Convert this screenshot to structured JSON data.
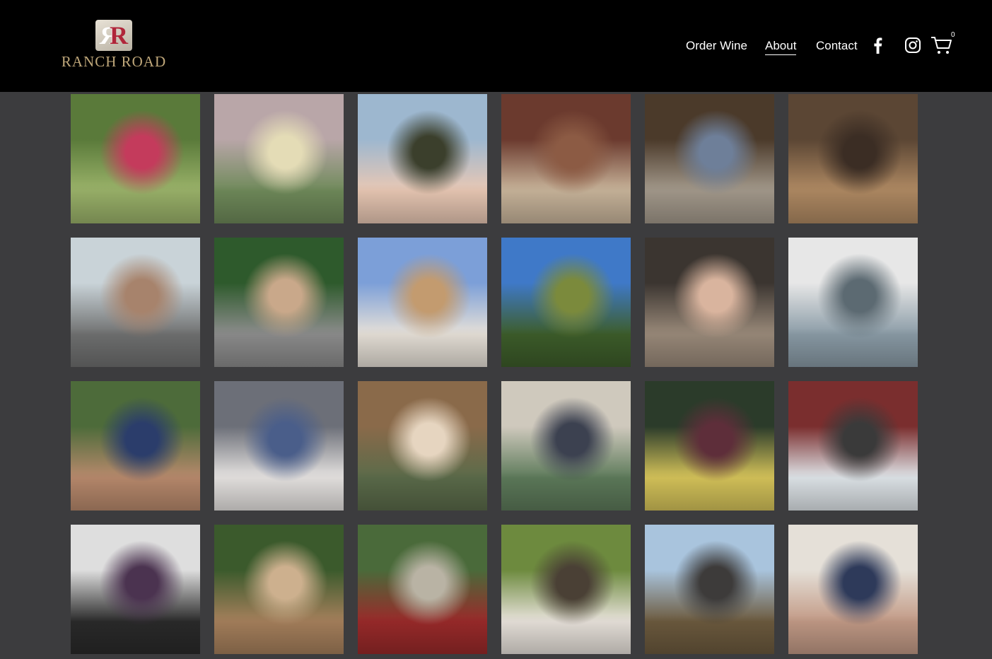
{
  "brand": {
    "name": "Ranch Road",
    "logo_text": "RANCH ROAD"
  },
  "nav": {
    "items": [
      {
        "label": "Order Wine",
        "active": false
      },
      {
        "label": "About",
        "active": true
      },
      {
        "label": "Contact",
        "active": false
      }
    ],
    "social": [
      "facebook-icon",
      "instagram-icon"
    ],
    "cart_count": "0"
  },
  "gallery": {
    "photos": [
      {
        "name": "woman-lounging-vineyard-photo",
        "colors": [
          "#5a7a3a",
          "#9bb36a",
          "#c43b5c"
        ]
      },
      {
        "name": "white-wine-glass-sunset-photo",
        "colors": [
          "#b9a6a8",
          "#6f8a5a",
          "#e4dcb6"
        ]
      },
      {
        "name": "ranch-road-wine-bottle-photo",
        "colors": [
          "#9db7cf",
          "#e9c8b4",
          "#3b3f2c"
        ]
      },
      {
        "name": "barrel-rack-photo",
        "colors": [
          "#6b3a2e",
          "#c9b59b",
          "#8c5b44"
        ]
      },
      {
        "name": "man-with-wine-glass-photo",
        "colors": [
          "#4b3a2a",
          "#a49a8c",
          "#6e7f99"
        ]
      },
      {
        "name": "woman-in-barrel-room-photo",
        "colors": [
          "#5b4634",
          "#b08a63",
          "#3b2d24"
        ]
      },
      {
        "name": "group-toasting-outdoors-photo",
        "colors": [
          "#c9d3d8",
          "#6f7070",
          "#a7836c"
        ]
      },
      {
        "name": "harvest-trailer-photo",
        "colors": [
          "#2e5a2c",
          "#8d8d8d",
          "#c9a88a"
        ]
      },
      {
        "name": "couple-smiling-photo",
        "colors": [
          "#7c9fd8",
          "#e7e1d8",
          "#c39b6f"
        ]
      },
      {
        "name": "hillside-vineyard-photo",
        "colors": [
          "#3f79c8",
          "#3d5d2a",
          "#7b8a3c"
        ]
      },
      {
        "name": "women-group-tasting-room-photo",
        "colors": [
          "#3b3530",
          "#9a8a7a",
          "#d9b49e"
        ]
      },
      {
        "name": "man-tasting-red-wine-photo",
        "colors": [
          "#e7e7e7",
          "#8a9ba6",
          "#5c6a72"
        ]
      },
      {
        "name": "man-drinking-from-bota-photo",
        "colors": [
          "#4d6b3a",
          "#b98a6d",
          "#2b3d6b"
        ]
      },
      {
        "name": "three-friends-photo",
        "colors": [
          "#6c6f78",
          "#e7e4e2",
          "#4a5e8a"
        ]
      },
      {
        "name": "four-friends-toasting-photo",
        "colors": [
          "#8a6a4a",
          "#5b6b4a",
          "#e6d5c0"
        ]
      },
      {
        "name": "young-man-cowboy-hat-photo",
        "colors": [
          "#cfc9bd",
          "#5d7a5a",
          "#3c4150"
        ]
      },
      {
        "name": "grapes-sunlight-photo",
        "colors": [
          "#2b3b2a",
          "#d6c45a",
          "#5e2e3a"
        ]
      },
      {
        "name": "two-men-red-wine-photo",
        "colors": [
          "#7a2e2e",
          "#e0e6ea",
          "#3a3a3a"
        ]
      },
      {
        "name": "crush-pad-workers-photo",
        "colors": [
          "#dedede",
          "#2a2a2a",
          "#4b3350"
        ]
      },
      {
        "name": "woman-on-trail-with-dog-photo",
        "colors": [
          "#3b5a2c",
          "#a6805c",
          "#cdb08e"
        ]
      },
      {
        "name": "man-on-atv-photo",
        "colors": [
          "#4a6a3a",
          "#9a2a2a",
          "#b9b3a4"
        ]
      },
      {
        "name": "family-in-vineyard-photo",
        "colors": [
          "#6d8a3e",
          "#e9e3dc",
          "#4a4035"
        ]
      },
      {
        "name": "woman-on-deck-photo",
        "colors": [
          "#a9c4dd",
          "#6c5a3e",
          "#3d3b3a"
        ]
      },
      {
        "name": "couple-selfie-photo",
        "colors": [
          "#e5e0d8",
          "#c29a86",
          "#2e3a5a"
        ]
      }
    ]
  }
}
